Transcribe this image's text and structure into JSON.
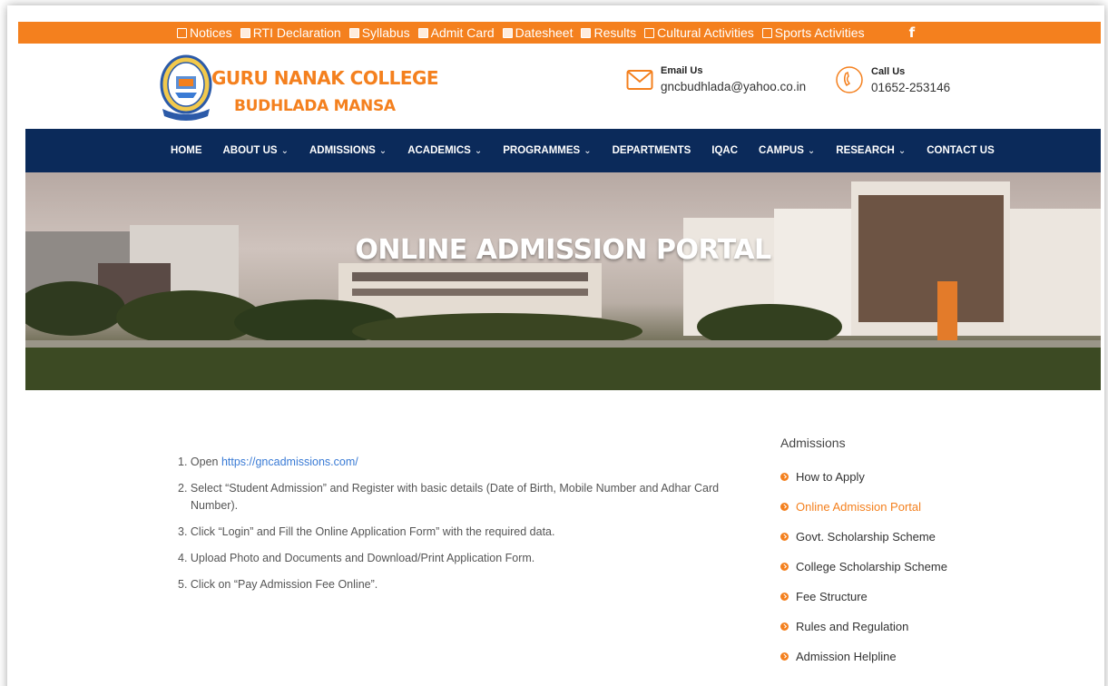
{
  "topbar": {
    "items": [
      "Notices",
      "RTI Declaration",
      "Syllabus",
      "Admit Card",
      "Datesheet",
      "Results",
      "Cultural Activities",
      "Sports Activities"
    ],
    "social": "f"
  },
  "header": {
    "college_name": "GURU NANAK COLLEGE",
    "location": "BUDHLADA MANSA",
    "email_label": "Email Us",
    "email": "gncbudhlada@yahoo.co.in",
    "phone_label": "Call Us",
    "phone": "01652-253146"
  },
  "nav": {
    "home": "HOME",
    "about": "ABOUT US",
    "admissions": "ADMISSIONS",
    "academics": "ACADEMICS",
    "programmes": "PROGRAMMES",
    "departments": "DEPARTMENTS",
    "iqac": "IQAC",
    "campus": "CAMPUS",
    "research": "RESEARCH",
    "contact": "CONTACT US"
  },
  "banner": {
    "title": "ONLINE ADMISSION PORTAL"
  },
  "steps": {
    "s1_prefix": "1. Open ",
    "s1_link": "https://gncadmissions.com/",
    "s2": "2. Select “Student Admission” and Register with basic details (Date of Birth, Mobile Number and Adhar Card Number).",
    "s3": "3. Click “Login” and Fill the Online Application Form” with the required data.",
    "s4": "4. Upload Photo and Documents and Download/Print Application Form.",
    "s5": "5. Click on “Pay Admission Fee Online”."
  },
  "sidebar": {
    "heading": "Admissions",
    "items": [
      "How to Apply",
      "Online Admission Portal",
      "Govt. Scholarship Scheme",
      "College Scholarship Scheme",
      "Fee Structure",
      "Rules and Regulation",
      "Admission Helpline"
    ]
  },
  "colors": {
    "orange": "#f4801e",
    "navy": "#0b2a5a"
  }
}
